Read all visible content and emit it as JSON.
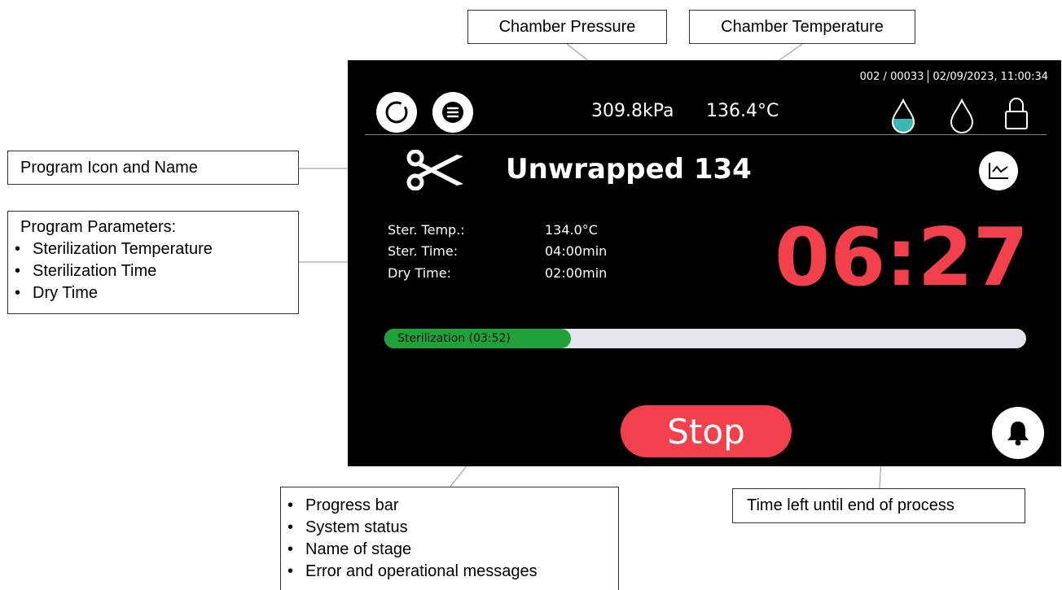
{
  "callouts": {
    "chamber_pressure": "Chamber Pressure",
    "chamber_temperature": "Chamber Temperature",
    "program_icon_name": "Program Icon and Name",
    "program_parameters": {
      "title": "Program Parameters:",
      "items": [
        "Sterilization Temperature",
        "Sterilization Time",
        "Dry Time"
      ]
    },
    "progress_info": [
      "Progress bar",
      "System status",
      "Name of stage",
      "Error and operational messages"
    ],
    "time_left": "Time left until end of process"
  },
  "screen": {
    "header": {
      "cycle_info": "002 / 00033",
      "datetime": "02/09/2023, 11:00:34",
      "pressure": "309.8kPa",
      "temperature": "136.4°C",
      "icons": [
        "refresh-icon",
        "menu-icon",
        "water-level-icon",
        "water-drop-icon",
        "lock-icon"
      ]
    },
    "program": {
      "icon": "scissors-icon",
      "name": "Unwrapped 134",
      "chart_icon": "chart-icon"
    },
    "parameters": {
      "ster_temp_label": "Ster. Temp.:",
      "ster_temp_value": "134.0°C",
      "ster_time_label": "Ster. Time:",
      "ster_time_value": "04:00min",
      "dry_time_label": "Dry Time:",
      "dry_time_value": "02:00min"
    },
    "timer": "06:27",
    "timer_color": "#f2404c",
    "progress": {
      "label": "Sterilization (03:52)",
      "fraction": 0.29,
      "fill_color": "#20a23a"
    },
    "stop_label": "Stop",
    "stop_color": "#f2404c",
    "bell_icon": "bell-icon"
  }
}
